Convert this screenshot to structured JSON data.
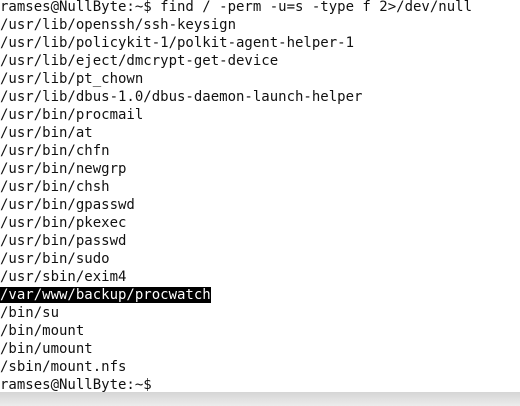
{
  "terminal": {
    "command_line": "ramses@NullByte:~$ find / -perm -u=s -type f 2>/dev/null",
    "output": [
      "/usr/lib/openssh/ssh-keysign",
      "/usr/lib/policykit-1/polkit-agent-helper-1",
      "/usr/lib/eject/dmcrypt-get-device",
      "/usr/lib/pt_chown",
      "/usr/lib/dbus-1.0/dbus-daemon-launch-helper",
      "/usr/bin/procmail",
      "/usr/bin/at",
      "/usr/bin/chfn",
      "/usr/bin/newgrp",
      "/usr/bin/chsh",
      "/usr/bin/gpasswd",
      "/usr/bin/pkexec",
      "/usr/bin/passwd",
      "/usr/bin/sudo",
      "/usr/sbin/exim4",
      "/var/www/backup/procwatch",
      "/bin/su",
      "/bin/mount",
      "/bin/umount",
      "/sbin/mount.nfs"
    ],
    "highlighted_line": "/var/www/backup/procwatch",
    "prompt": "ramses@NullByte:~$",
    "colors": {
      "background": "#ffffff",
      "text": "#111111",
      "selection_background": "#000000",
      "selection_text": "#ffffff"
    }
  }
}
